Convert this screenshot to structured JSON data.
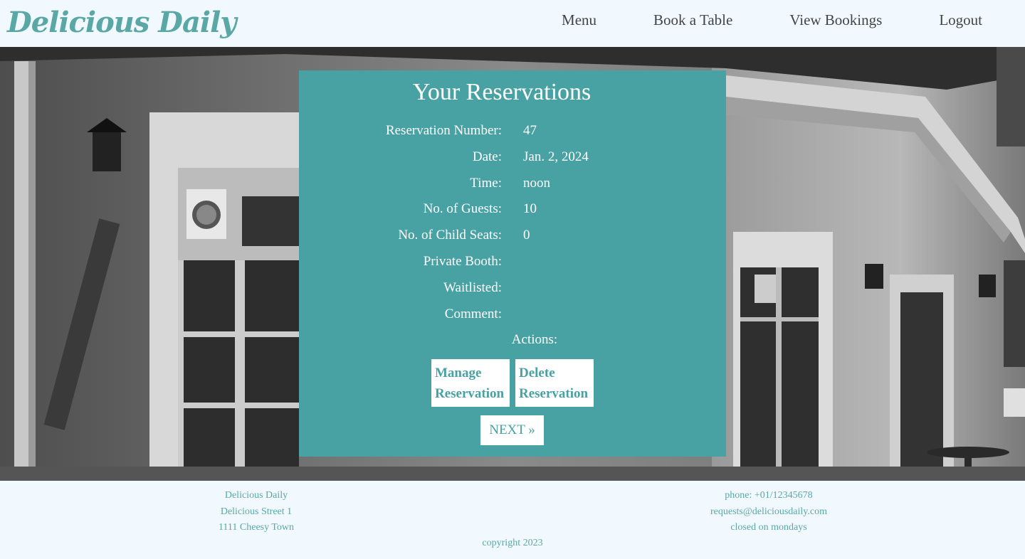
{
  "header": {
    "logo": "Delicious Daily",
    "nav": [
      "Menu",
      "Book a Table",
      "View Bookings",
      "Logout"
    ]
  },
  "card": {
    "title": "Your Reservations",
    "rows": [
      {
        "label": "Reservation Number:",
        "value": "47"
      },
      {
        "label": "Date:",
        "value": "Jan. 2, 2024"
      },
      {
        "label": "Time:",
        "value": "noon"
      },
      {
        "label": "No. of Guests:",
        "value": "10"
      },
      {
        "label": "No. of Child Seats:",
        "value": "0"
      },
      {
        "label": "Private Booth:",
        "value": ""
      },
      {
        "label": "Waitlisted:",
        "value": ""
      },
      {
        "label": "Comment:",
        "value": ""
      }
    ],
    "actions_label": "Actions:",
    "manage_button": "Manage Reservation",
    "delete_button": "Delete Reservation",
    "next_button": "NEXT »"
  },
  "footer": {
    "left": [
      "Delicious Daily",
      "Delicious Street 1",
      "1111 Cheesy Town"
    ],
    "right": [
      "phone: +01/12345678",
      "requests@deliciousdaily.com",
      "closed on mondays"
    ],
    "copyright": "copyright 2023"
  },
  "colors": {
    "accent": "#48a1a2",
    "logo": "#5aa8a6",
    "background": "#f1f8fe"
  }
}
